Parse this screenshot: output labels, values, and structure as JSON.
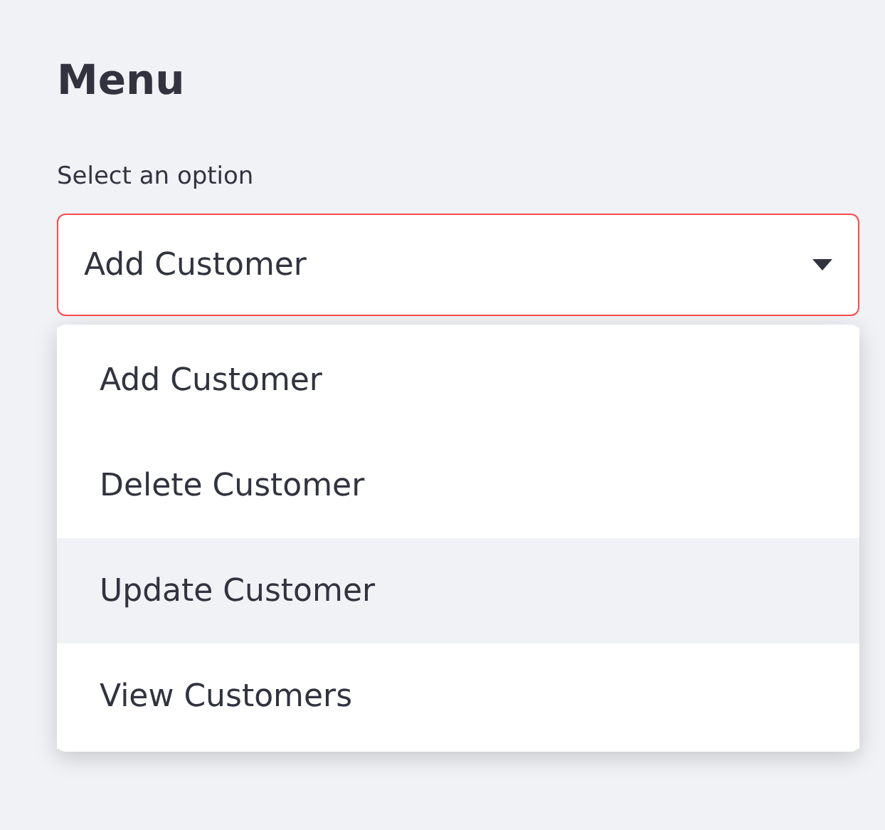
{
  "title": "Menu",
  "select": {
    "label": "Select an option",
    "value": "Add Customer",
    "focused": true,
    "options": [
      {
        "label": "Add Customer",
        "highlighted": false
      },
      {
        "label": "Delete Customer",
        "highlighted": false
      },
      {
        "label": "Update Customer",
        "highlighted": true
      },
      {
        "label": "View Customers",
        "highlighted": false
      }
    ]
  }
}
